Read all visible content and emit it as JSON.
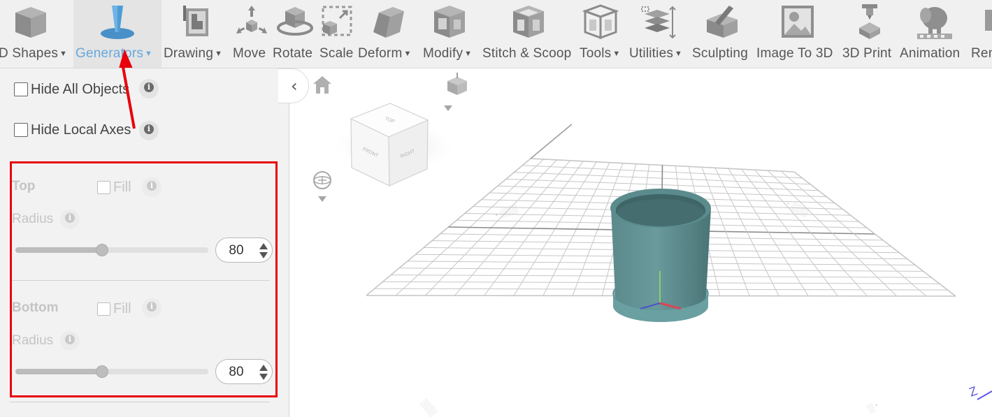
{
  "toolbar": {
    "items": [
      {
        "label": "D Shapes",
        "icon": "cube-icon",
        "has_dropdown": true
      },
      {
        "label": "Generators",
        "icon": "generator-icon",
        "has_dropdown": true,
        "active": true
      },
      {
        "label": "Drawing",
        "icon": "drawing-icon",
        "has_dropdown": true
      },
      {
        "label": "Move",
        "icon": "move-icon",
        "has_dropdown": false
      },
      {
        "label": "Rotate",
        "icon": "rotate-icon",
        "has_dropdown": false
      },
      {
        "label": "Scale",
        "icon": "scale-icon",
        "has_dropdown": false
      },
      {
        "label": "Deform",
        "icon": "deform-icon",
        "has_dropdown": true
      },
      {
        "label": "Modify",
        "icon": "modify-icon",
        "has_dropdown": true
      },
      {
        "label": "Stitch & Scoop",
        "icon": "stitch-scoop-icon",
        "has_dropdown": false
      },
      {
        "label": "Tools",
        "icon": "tools-icon",
        "has_dropdown": true
      },
      {
        "label": "Utilities",
        "icon": "utilities-icon",
        "has_dropdown": true
      },
      {
        "label": "Sculpting",
        "icon": "sculpting-icon",
        "has_dropdown": false
      },
      {
        "label": "Image To 3D",
        "icon": "image-to-3d-icon",
        "has_dropdown": false
      },
      {
        "label": "3D Print",
        "icon": "3d-print-icon",
        "has_dropdown": false
      },
      {
        "label": "Animation",
        "icon": "animation-icon",
        "has_dropdown": false
      },
      {
        "label": "Ren",
        "icon": "render-icon",
        "has_dropdown": false
      }
    ],
    "active_color": "#68a9dd"
  },
  "panel": {
    "hide_all_objects": {
      "label": "Hide All Objects",
      "checked": false
    },
    "hide_local_axes": {
      "label": "Hide Local Axes",
      "checked": false
    },
    "top": {
      "title": "Top",
      "fill_label": "Fill",
      "fill_checked": false,
      "radius_label": "Radius",
      "radius_value": "80",
      "slider_fraction": 0.45
    },
    "bottom": {
      "title": "Bottom",
      "fill_label": "Fill",
      "fill_checked": false,
      "radius_label": "Radius",
      "radius_value": "80",
      "slider_fraction": 0.45
    }
  },
  "viewport": {
    "view_cube": {
      "top": "TOP",
      "front": "FRONT",
      "right": "RIGHT"
    },
    "object_color": "#4f7d7f",
    "highlight_color": "#e8000b"
  }
}
